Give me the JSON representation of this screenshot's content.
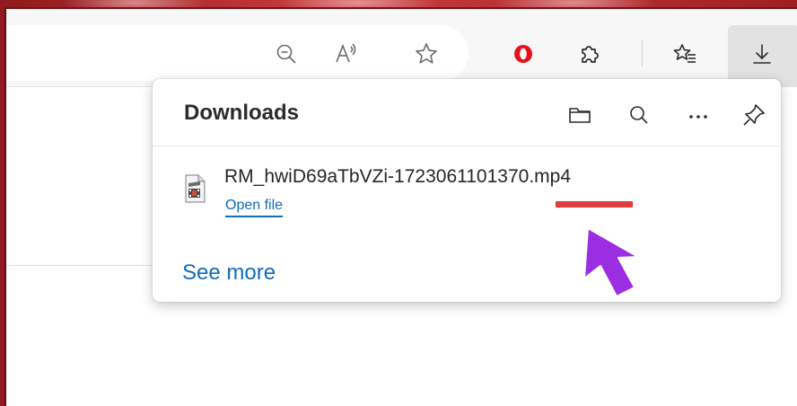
{
  "downloads": {
    "title": "Downloads",
    "file_name": "RM_hwiD69aTbVZi-1723061101370.mp4",
    "open_file_label": "Open file",
    "see_more_label": "See more"
  },
  "icons": {
    "toolbar": [
      "zoom-out-icon",
      "read-aloud-icon",
      "favorite-star-icon",
      "opera-extension-icon",
      "extensions-puzzle-icon",
      "favorites-list-icon",
      "download-icon"
    ],
    "panel": [
      "open-folder-icon",
      "search-icon",
      "more-icon",
      "pin-icon"
    ],
    "file": "video-file-icon"
  },
  "colors": {
    "link": "#0f6cbd",
    "highlight_underline": "#e23c3c",
    "pointer_arrow": "#9b2ee0",
    "opera_red": "#e5121e"
  }
}
